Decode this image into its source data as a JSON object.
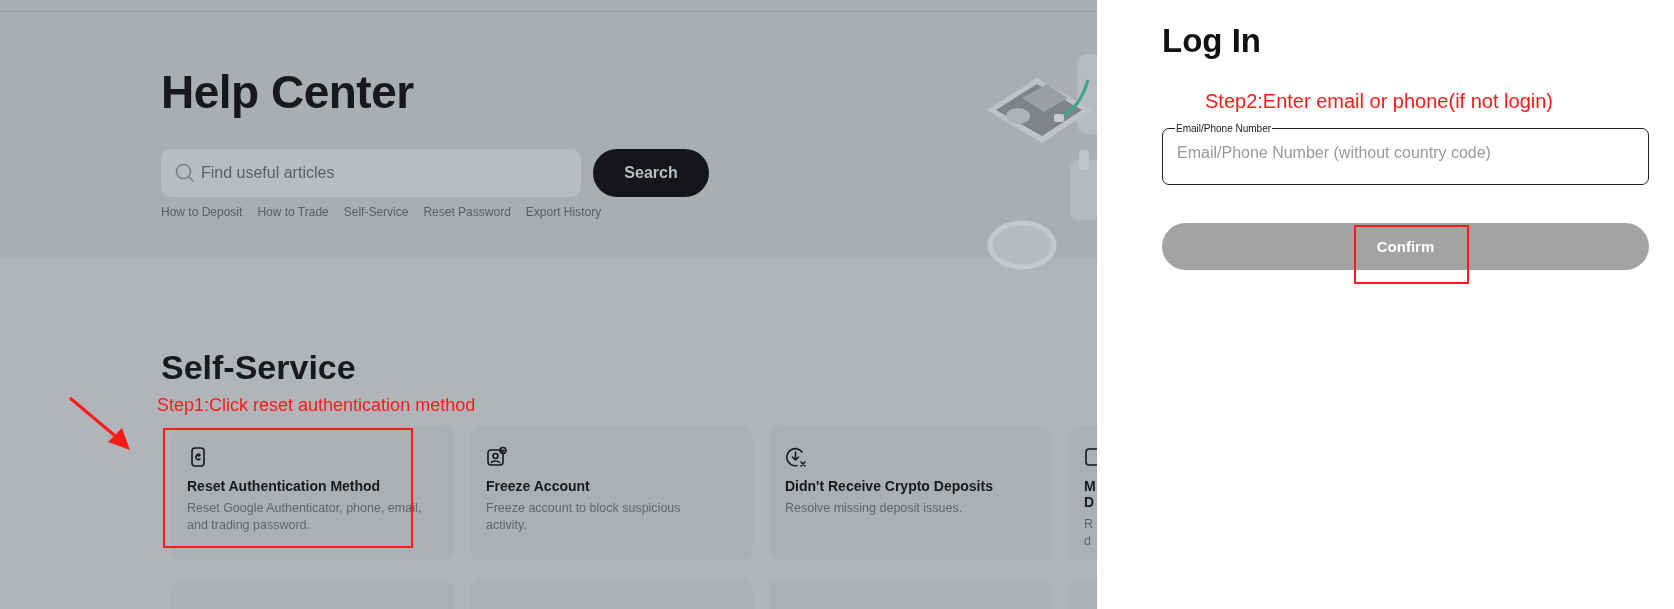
{
  "help_center": {
    "title": "Help Center",
    "search": {
      "placeholder": "Find useful articles",
      "button": "Search"
    },
    "quick_links": [
      "How to Deposit",
      "How to Trade",
      "Self-Service",
      "Reset Password",
      "Export History"
    ]
  },
  "self_service": {
    "title": "Self-Service",
    "annotation": "Step1:Click reset authentication method",
    "cards": [
      {
        "kind": "phone",
        "title": [
          "Reset Authentication Method"
        ],
        "description": [
          "Reset Google Authenticator, phone, email,",
          "and trading password."
        ],
        "highlighted": true
      },
      {
        "kind": "portrait",
        "title": [
          "Freeze Account"
        ],
        "description": [
          "Freeze account to block suspicious",
          "activity."
        ],
        "highlighted": false
      },
      {
        "kind": "download",
        "title": [
          "Didn't Receive Crypto Deposits"
        ],
        "description": [
          "Resolve missing deposit issues."
        ],
        "highlighted": false
      },
      {
        "kind": "square",
        "title": [
          "M",
          "D"
        ],
        "description": [
          "R",
          "d"
        ],
        "highlighted": false
      }
    ]
  },
  "login": {
    "title": "Log In",
    "annotation": "Step2:Enter email or phone(if not login)",
    "field": {
      "label": "Email/Phone Number",
      "placeholder": "Email/Phone Number (without country code)"
    },
    "button": {
      "label": "Confirm",
      "disabled": true,
      "highlighted": true
    }
  }
}
